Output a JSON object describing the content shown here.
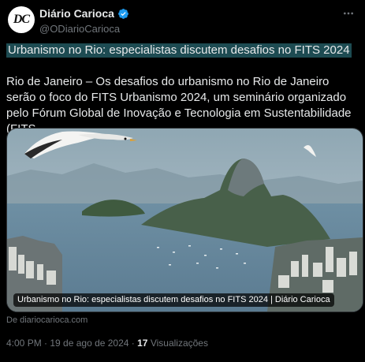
{
  "author": {
    "avatar_text": "DC",
    "name": "Diário Carioca",
    "handle": "@ODiarioCarioca"
  },
  "post": {
    "headline": "Urbanismo no Rio: especialistas discutem desafios no FITS 2024",
    "body": "Rio de Janeiro – Os desafios do urbanismo no Rio de Janeiro serão o foco do FITS Urbanismo 2024, um seminário organizado pelo Fórum Global de Inovação e Tecnologia em Sustentabilidade (FITS...",
    "media_caption": "Urbanismo no Rio: especialistas discutem desafios no FITS 2024 | Diário Carioca",
    "source": "De diariocarioca.com"
  },
  "meta": {
    "time": "4:00 PM · 19 de ago de 2024 · ",
    "views_count": "17",
    "views_label": " Visualizações"
  },
  "colors": {
    "verified": "#1d9bf0",
    "highlight": "#1d4b52",
    "muted": "#71767b"
  },
  "icons": [
    "verified-badge-icon",
    "more-options-icon"
  ]
}
